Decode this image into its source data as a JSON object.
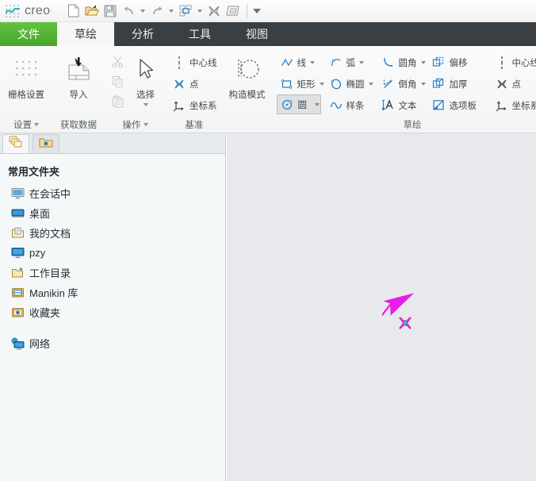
{
  "app": {
    "brand": "creo",
    "brand_reg": "·"
  },
  "quick_access": {
    "items": [
      {
        "name": "new-document",
        "icon": "new-file-icon",
        "label": "新建"
      },
      {
        "name": "open-document",
        "icon": "open-folder-icon",
        "label": "打开"
      },
      {
        "name": "save-document",
        "icon": "save-disk-icon",
        "label": "保存"
      },
      {
        "name": "undo",
        "icon": "undo-arrow-icon",
        "label": "撤消"
      },
      {
        "name": "redo",
        "icon": "redo-arrow-icon",
        "label": "重做"
      },
      {
        "name": "regenerate",
        "icon": "regenerate-icon",
        "label": "重新生成"
      },
      {
        "name": "close-window",
        "icon": "close-x-icon",
        "label": "关闭"
      },
      {
        "name": "window-layers",
        "icon": "window-layers-icon",
        "label": "窗口"
      },
      {
        "name": "customize-qat",
        "icon": "chevron-down-icon",
        "label": "自定义"
      }
    ]
  },
  "ribbon": {
    "tabs": [
      {
        "label": "文件",
        "state": "file"
      },
      {
        "label": "草绘",
        "state": "active"
      },
      {
        "label": "分析",
        "state": "normal"
      },
      {
        "label": "工具",
        "state": "normal"
      },
      {
        "label": "视图",
        "state": "normal"
      }
    ],
    "groups": [
      {
        "name": "setup",
        "label": "设置",
        "has_launcher": true,
        "big_buttons": [
          {
            "label": "栅格设置",
            "icon": "grid-dots-icon"
          }
        ]
      },
      {
        "name": "get-data",
        "label": "获取数据",
        "has_launcher": false,
        "big_buttons": [
          {
            "label": "导入",
            "icon": "import-document-icon"
          }
        ]
      },
      {
        "name": "operations",
        "label": "操作",
        "has_launcher": true,
        "small_buttons": [
          {
            "label": "",
            "icon": "cut-scissors-icon",
            "disabled": true
          },
          {
            "label": "",
            "icon": "copy-pages-icon",
            "disabled": true
          },
          {
            "label": "",
            "icon": "paste-clipboard-icon",
            "disabled": true
          }
        ],
        "big_buttons": [
          {
            "label": "选择",
            "icon": "cursor-arrow-icon",
            "has_dropdown": true
          }
        ]
      },
      {
        "name": "datum",
        "label": "基准",
        "has_launcher": false,
        "small_buttons": [
          {
            "label": "中心线",
            "icon": "centerline-icon"
          },
          {
            "label": "点",
            "icon": "point-cross-icon"
          },
          {
            "label": "坐标系",
            "icon": "coordinate-system-icon"
          }
        ]
      },
      {
        "name": "construction-mode",
        "label": "",
        "has_launcher": false,
        "big_buttons": [
          {
            "label": "构造模式",
            "icon": "construction-circle-icon"
          }
        ]
      },
      {
        "name": "sketching",
        "label": "草绘",
        "has_launcher": false,
        "columns": [
          [
            {
              "label": "线",
              "icon": "line-icon",
              "has_dropdown": true
            },
            {
              "label": "矩形",
              "icon": "rectangle-icon",
              "has_dropdown": true
            },
            {
              "label": "圆",
              "icon": "circle-icon",
              "has_dropdown": true,
              "active": true
            }
          ],
          [
            {
              "label": "弧",
              "icon": "arc-icon",
              "has_dropdown": true
            },
            {
              "label": "椭圆",
              "icon": "ellipse-icon",
              "has_dropdown": true
            },
            {
              "label": "样条",
              "icon": "spline-icon"
            }
          ],
          [
            {
              "label": "圆角",
              "icon": "fillet-icon",
              "has_dropdown": true
            },
            {
              "label": "倒角",
              "icon": "chamfer-icon",
              "has_dropdown": true
            },
            {
              "label": "文本",
              "icon": "text-a-icon"
            }
          ],
          [
            {
              "label": "偏移",
              "icon": "offset-icon"
            },
            {
              "label": "加厚",
              "icon": "thicken-icon"
            },
            {
              "label": "选项板",
              "icon": "palette-icon"
            }
          ],
          [
            {
              "label": "中心线",
              "icon": "centerline-icon",
              "has_dropdown": true
            },
            {
              "label": "点",
              "icon": "point-cross-icon"
            },
            {
              "label": "坐标系",
              "icon": "coordinate-system-icon"
            }
          ]
        ]
      }
    ]
  },
  "navigator": {
    "tabs": [
      {
        "name": "folder-browser",
        "icon": "folders-stack-icon",
        "selected": true
      },
      {
        "name": "favorites-browser",
        "icon": "favorites-folder-icon",
        "selected": false
      }
    ],
    "header": "常用文件夹",
    "items": [
      {
        "label": "在会话中",
        "icon": "session-monitor-icon"
      },
      {
        "label": "桌面",
        "icon": "desktop-icon"
      },
      {
        "label": "我的文档",
        "icon": "my-documents-icon"
      },
      {
        "label": "pzy",
        "icon": "computer-monitor-icon"
      },
      {
        "label": "工作目录",
        "icon": "working-directory-icon"
      },
      {
        "label": "Manikin 库",
        "icon": "manikin-library-icon"
      },
      {
        "label": "收藏夹",
        "icon": "favorites-folder-icon"
      }
    ],
    "footer_items": [
      {
        "label": "网络",
        "icon": "network-icon"
      }
    ]
  },
  "canvas": {
    "name": "sketch-graphics-area",
    "annotation": {
      "name": "magenta-pointer-arrow",
      "color": "#e81ee8"
    },
    "sketch_point": {
      "name": "sketch-point-marker",
      "color": "#cc2fcc",
      "center_color": "#2fb6c8"
    }
  },
  "colors": {
    "file_tab_green": "#4aa52c",
    "tabstrip_dark": "#3a3f44",
    "canvas_bg": "#e8e9ec",
    "nav_bg": "#f5f8f9",
    "icon_blue": "#2b7fc4",
    "accent_magenta": "#e81ee8"
  }
}
